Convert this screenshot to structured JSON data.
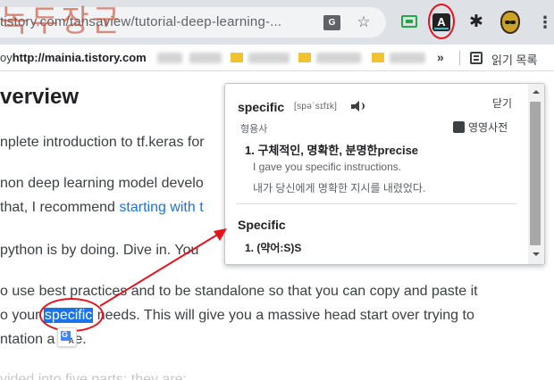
{
  "watermark": "녹두장군",
  "browser": {
    "url": "tistory.com/tansaview/tutorial-deep-learning-...",
    "icons": [
      "translate-icon",
      "star-icon",
      "green-extension-icon",
      "dictionary-extension-icon",
      "puzzle-icon",
      "mask-extension-icon",
      "menu-icon"
    ],
    "translate_icon_text": "G",
    "star_glyph": "☆",
    "dict_ext_glyph": "A",
    "puzzle_glyph": "✱",
    "menu_glyph": "⋮"
  },
  "bookmarks": {
    "prefix": "oy",
    "site": "http://mainia.tistory.com",
    "chevron": "»",
    "reading_list": "읽기 목록"
  },
  "page": {
    "heading": "verview",
    "lines": [
      "nplete introduction to tf.keras for",
      "non deep learning model develo",
      "that, I recommend ",
      "python is by doing. Dive in. You"
    ],
    "link_text": "starting with",
    "link_tail": "t",
    "line5": "o use best practices and to be standalone so that you can copy and paste it",
    "line6_pre": "o your ",
    "selected_word": "specific",
    "line6_post": " needs. This will give you a massive head start over trying to",
    "line7": "ntation a",
    "line7_tail": "e.",
    "line8": "vided into five parts; they are:",
    "translate_badge": "A"
  },
  "popup": {
    "word": "specific",
    "phonetic": "[spəˈsɪfɪk]",
    "close_label": "닫기",
    "part_of_speech": "형용사",
    "dict_link": "영영사전",
    "definition": "1. 구체적인, 명확한, 분명한precise",
    "example_en": "I gave you specific instructions.",
    "example_ko": "내가 당신에게 명확한 지시를 내렸었다.",
    "word2": "Specific",
    "definition2": "1. (약어:S)S"
  },
  "colors": {
    "accent": "#1a73e8",
    "annotation_red": "#e8101a",
    "chrome_bg": "#dee1e6"
  }
}
